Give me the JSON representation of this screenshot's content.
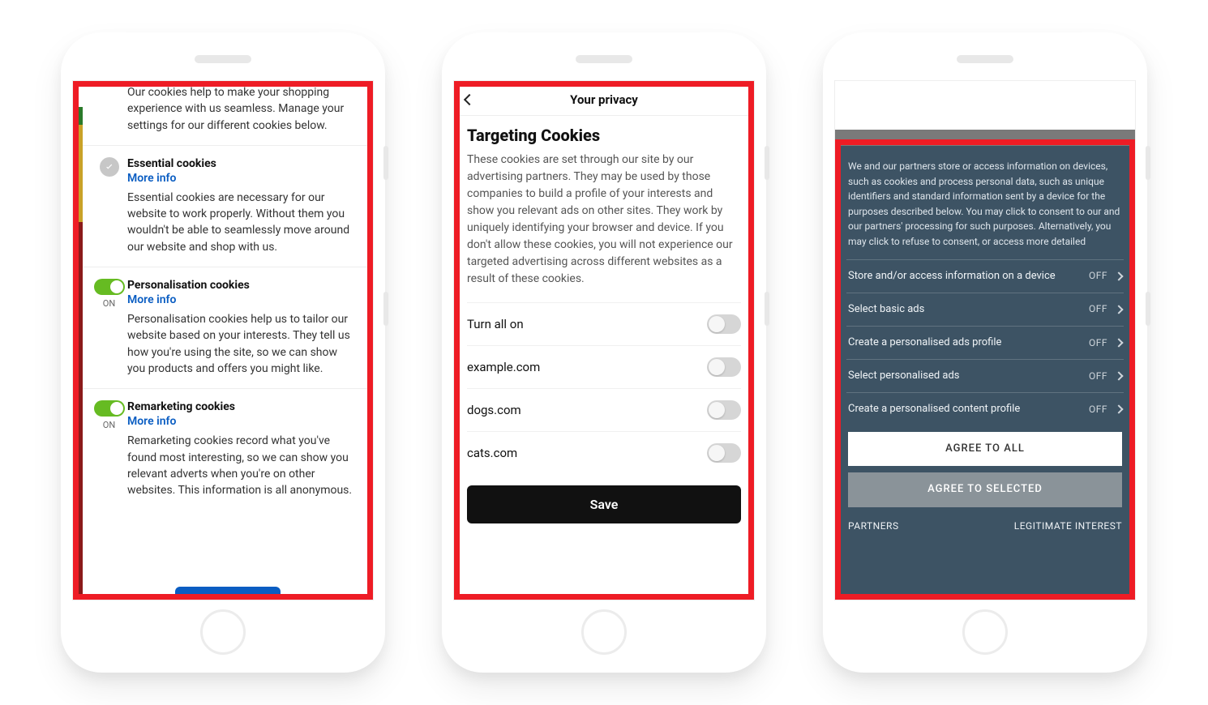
{
  "phone1": {
    "intro": "Our cookies help to make your shopping experience with us seamless. Manage your settings for our different cookies below.",
    "more_info_label": "More info",
    "sections": [
      {
        "title": "Essential cookies",
        "desc": "Essential cookies are necessary for our website to work properly. Without them you wouldn't be able to seamlessly move around our website and shop with us."
      },
      {
        "title": "Personalisation cookies",
        "state_label": "ON",
        "desc": "Personalisation cookies help us to tailor our website based on your interests. They tell us how you're using the site, so we can show you products and offers you might like."
      },
      {
        "title": "Remarketing cookies",
        "state_label": "ON",
        "desc": "Remarketing cookies record what you've found most interesting, so we can show you relevant adverts when you're on other websites. This information is all anonymous."
      }
    ]
  },
  "phone2": {
    "header_title": "Your privacy",
    "main_title": "Targeting Cookies",
    "description": "These cookies are set through our site by our advertising partners. They may be used by those companies to build a profile of your interests and show you relevant ads on other sites. They work by uniquely identifying your browser and device. If you don't allow these cookies, you will not experience our targeted advertising across different websites as a result of these cookies.",
    "turn_all_label": "Turn all on",
    "rows": [
      "example.com",
      "dogs.com",
      "cats.com"
    ],
    "save_label": "Save"
  },
  "phone3": {
    "intro": "We and our partners store or access information on devices, such as cookies and process personal data, such as unique identifiers and standard information sent by a device for the purposes described below. You may click to consent to our and our partners' processing for such purposes. Alternatively, you may click to refuse to consent, or access more detailed",
    "off_label": "OFF",
    "options": [
      "Store and/or access information on a device",
      "Select basic ads",
      "Create a personalised ads profile",
      "Select personalised ads",
      "Create a personalised content profile"
    ],
    "agree_all": "AGREE TO ALL",
    "agree_selected": "AGREE TO SELECTED",
    "partners": "PARTNERS",
    "legitimate": "LEGITIMATE INTEREST"
  }
}
